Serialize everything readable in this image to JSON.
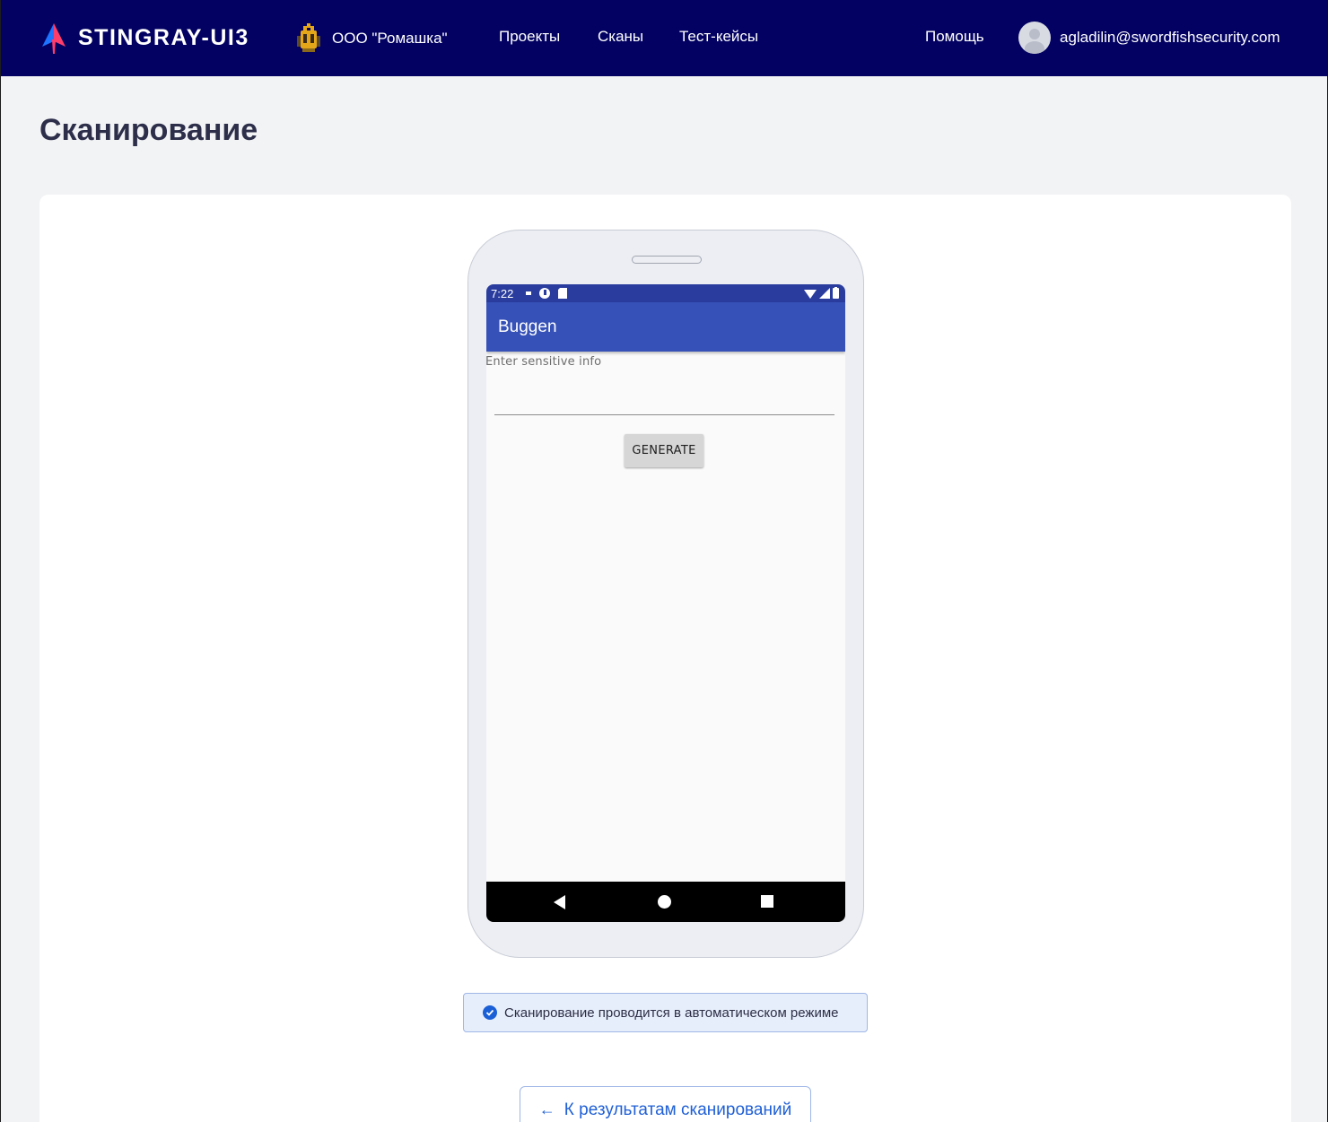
{
  "header": {
    "brand": "STINGRAY-UI3",
    "organization": "ООО \"Ромашка\"",
    "nav": [
      {
        "label": "Проекты"
      },
      {
        "label": "Сканы"
      },
      {
        "label": "Тест-кейсы"
      }
    ],
    "help": "Помощь",
    "user_email": "agladilin@swordfishsecurity.com"
  },
  "page": {
    "title": "Сканирование"
  },
  "device": {
    "status_time": "7:22",
    "app_title": "Buggen",
    "input_hint": "Enter sensitive info",
    "input_value": "",
    "button_label": "GENERATE"
  },
  "info": {
    "text": "Сканирование проводится в автоматическом режиме"
  },
  "back_link": {
    "label": "К результатам сканирований"
  },
  "colors": {
    "topbar": "#030262",
    "status_bar": "#2a3d9e",
    "app_bar": "#3651b8",
    "accent": "#2060d6"
  },
  "icons": {
    "logo": "stingray-logo-icon",
    "org": "coat-of-arms-icon",
    "avatar": "user-avatar-icon",
    "info": "check-circle-icon",
    "back": "arrow-left-icon"
  }
}
